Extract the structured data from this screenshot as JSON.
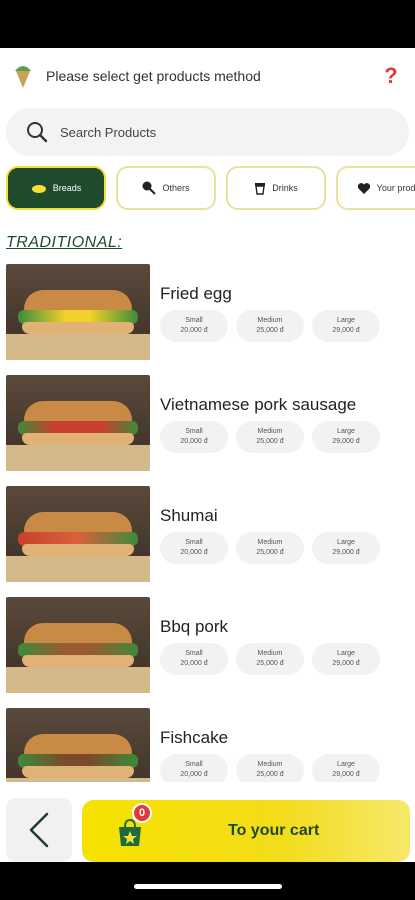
{
  "topbar": {
    "title": "Please select get products method",
    "help": "?"
  },
  "search": {
    "placeholder": "Search Products"
  },
  "categories": [
    {
      "label": "Breads",
      "icon": "bread-icon",
      "active": true
    },
    {
      "label": "Others",
      "icon": "drumstick-icon",
      "active": false
    },
    {
      "label": "Drinks",
      "icon": "cup-icon",
      "active": false
    },
    {
      "label": "Your prod",
      "icon": "heart-icon",
      "active": false
    }
  ],
  "section": {
    "title": "TRADITIONAL:"
  },
  "products": [
    {
      "name": "Fried egg",
      "sizes": [
        {
          "label": "Small",
          "price": "20,000 đ"
        },
        {
          "label": "Medium",
          "price": "25,000 đ"
        },
        {
          "label": "Large",
          "price": "29,000 đ"
        }
      ]
    },
    {
      "name": "Vietnamese pork sausage",
      "sizes": [
        {
          "label": "Small",
          "price": "20,000 đ"
        },
        {
          "label": "Medium",
          "price": "25,000 đ"
        },
        {
          "label": "Large",
          "price": "29,000 đ"
        }
      ]
    },
    {
      "name": "Shumai",
      "sizes": [
        {
          "label": "Small",
          "price": "20,000 đ"
        },
        {
          "label": "Medium",
          "price": "25,000 đ"
        },
        {
          "label": "Large",
          "price": "29,000 đ"
        }
      ]
    },
    {
      "name": "Bbq pork",
      "sizes": [
        {
          "label": "Small",
          "price": "20,000 đ"
        },
        {
          "label": "Medium",
          "price": "25,000 đ"
        },
        {
          "label": "Large",
          "price": "29,000 đ"
        }
      ]
    },
    {
      "name": "Fishcake",
      "sizes": [
        {
          "label": "Small",
          "price": "20,000 đ"
        },
        {
          "label": "Medium",
          "price": "25,000 đ"
        },
        {
          "label": "Large",
          "price": "29,000 đ"
        }
      ]
    }
  ],
  "cart": {
    "label": "To your cart",
    "count": "0"
  },
  "colors": {
    "brand_green": "#1f4b2d",
    "brand_yellow": "#f6e200",
    "badge_red": "#e53935"
  }
}
